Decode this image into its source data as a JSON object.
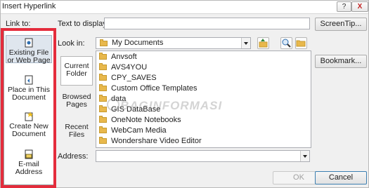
{
  "window": {
    "title": "Insert Hyperlink",
    "help": "?",
    "close": "X"
  },
  "link_to": {
    "label": "Link to:",
    "items": [
      {
        "label_line1": "Existing File",
        "label_line2": "or Web Page",
        "icon": "existing-file-icon",
        "selected": true
      },
      {
        "label_line1": "Place in This",
        "label_line2": "Document",
        "icon": "place-in-document-icon",
        "selected": false
      },
      {
        "label_line1": "Create New",
        "label_line2": "Document",
        "icon": "new-document-icon",
        "selected": false
      },
      {
        "label_line1": "E-mail",
        "label_line2": "Address",
        "icon": "email-icon",
        "selected": false
      }
    ]
  },
  "text_to_display": {
    "label": "Text to display:",
    "value": ""
  },
  "screentip": {
    "label": "ScreenTip..."
  },
  "look_in": {
    "label": "Look in:",
    "value": "My Documents"
  },
  "places": [
    {
      "line1": "Current",
      "line2": "Folder",
      "selected": true
    },
    {
      "line1": "Browsed",
      "line2": "Pages",
      "selected": false
    },
    {
      "line1": "Recent",
      "line2": "Files",
      "selected": false
    }
  ],
  "files": [
    "Anvsoft",
    "AVS4YOU",
    "CPY_SAVES",
    "Custom Office Templates",
    "data",
    "GIS DataBase",
    "OneNote Notebooks",
    "WebCam Media",
    "Wondershare Video Editor"
  ],
  "bookmark": {
    "label": "Bookmark..."
  },
  "address": {
    "label": "Address:",
    "value": ""
  },
  "ok": {
    "label": "OK"
  },
  "cancel": {
    "label": "Cancel"
  },
  "watermark": {
    "text": "BAGINFORMASI"
  },
  "colors": {
    "highlight_frame": "#e42c3c",
    "folder": "#e8b84c"
  }
}
